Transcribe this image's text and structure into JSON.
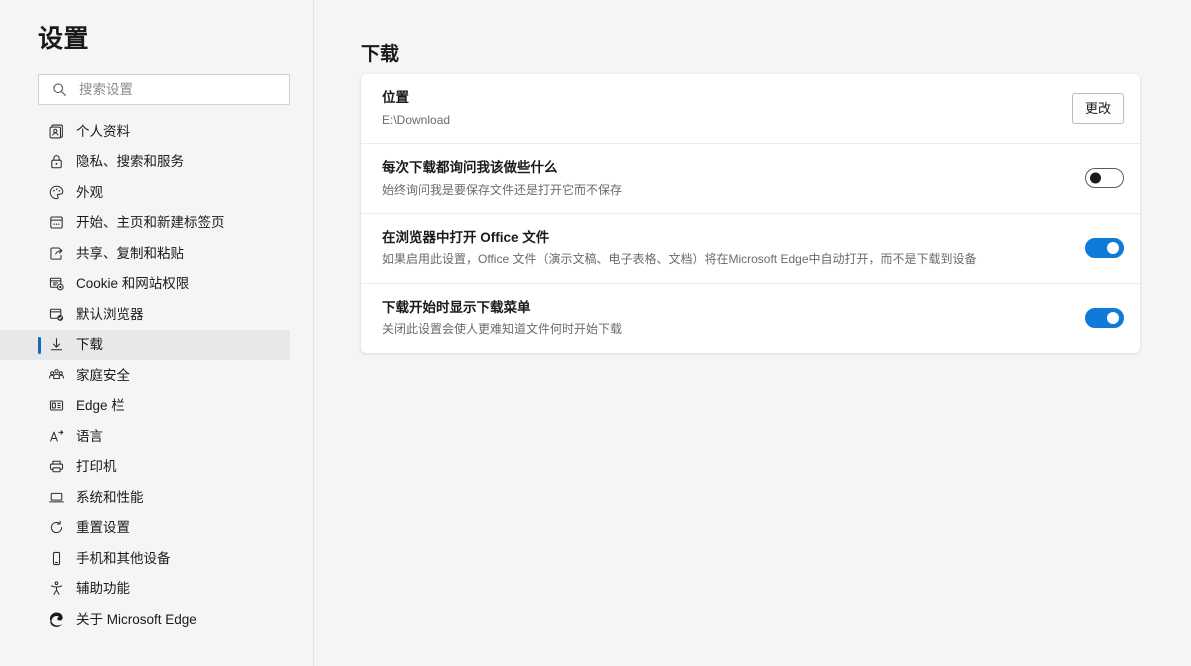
{
  "sidebar": {
    "title": "设置",
    "search": {
      "placeholder": "搜索设置",
      "value": "",
      "icon": "search-icon"
    },
    "items": [
      {
        "label": "个人资料",
        "icon": "profile-card-icon",
        "selected": false
      },
      {
        "label": "隐私、搜索和服务",
        "icon": "lock-icon",
        "selected": false
      },
      {
        "label": "外观",
        "icon": "palette-icon",
        "selected": false
      },
      {
        "label": "开始、主页和新建标签页",
        "icon": "new-tab-page-icon",
        "selected": false
      },
      {
        "label": "共享、复制和粘贴",
        "icon": "share-icon",
        "selected": false
      },
      {
        "label": "Cookie 和网站权限",
        "icon": "cookie-permissions-icon",
        "selected": false
      },
      {
        "label": "默认浏览器",
        "icon": "default-browser-check-icon",
        "selected": false
      },
      {
        "label": "下载",
        "icon": "download-arrow-icon",
        "selected": true
      },
      {
        "label": "家庭安全",
        "icon": "family-group-icon",
        "selected": false
      },
      {
        "label": "Edge 栏",
        "icon": "edge-bar-icon",
        "selected": false
      },
      {
        "label": "语言",
        "icon": "language-icon",
        "selected": false
      },
      {
        "label": "打印机",
        "icon": "printer-icon",
        "selected": false
      },
      {
        "label": "系统和性能",
        "icon": "laptop-icon",
        "selected": false
      },
      {
        "label": "重置设置",
        "icon": "reset-arrow-icon",
        "selected": false
      },
      {
        "label": "手机和其他设备",
        "icon": "phone-icon",
        "selected": false
      },
      {
        "label": "辅助功能",
        "icon": "accessibility-person-icon",
        "selected": false
      },
      {
        "label": "关于 Microsoft Edge",
        "icon": "edge-logo-icon",
        "selected": false
      }
    ]
  },
  "main": {
    "page_title": "下载",
    "rows": [
      {
        "title": "位置",
        "desc": "E:\\Download",
        "control": "button",
        "button_label": "更改"
      },
      {
        "title": "每次下载都询问我该做些什么",
        "desc": "始终询问我是要保存文件还是打开它而不保存",
        "control": "toggle",
        "toggle_state": "off"
      },
      {
        "title": "在浏览器中打开 Office 文件",
        "desc": "如果启用此设置，Office 文件（演示文稿、电子表格、文档）将在Microsoft Edge中自动打开，而不是下载到设备",
        "control": "toggle",
        "toggle_state": "on"
      },
      {
        "title": "下载开始时显示下载菜单",
        "desc": "关闭此设置会使人更难知道文件何时开始下载",
        "control": "toggle",
        "toggle_state": "on"
      }
    ]
  },
  "colors": {
    "accent": "#0f7ad8",
    "selected_bar": "#0f6cbd",
    "page_bg": "#f5f5f5",
    "card_bg": "#ffffff"
  }
}
